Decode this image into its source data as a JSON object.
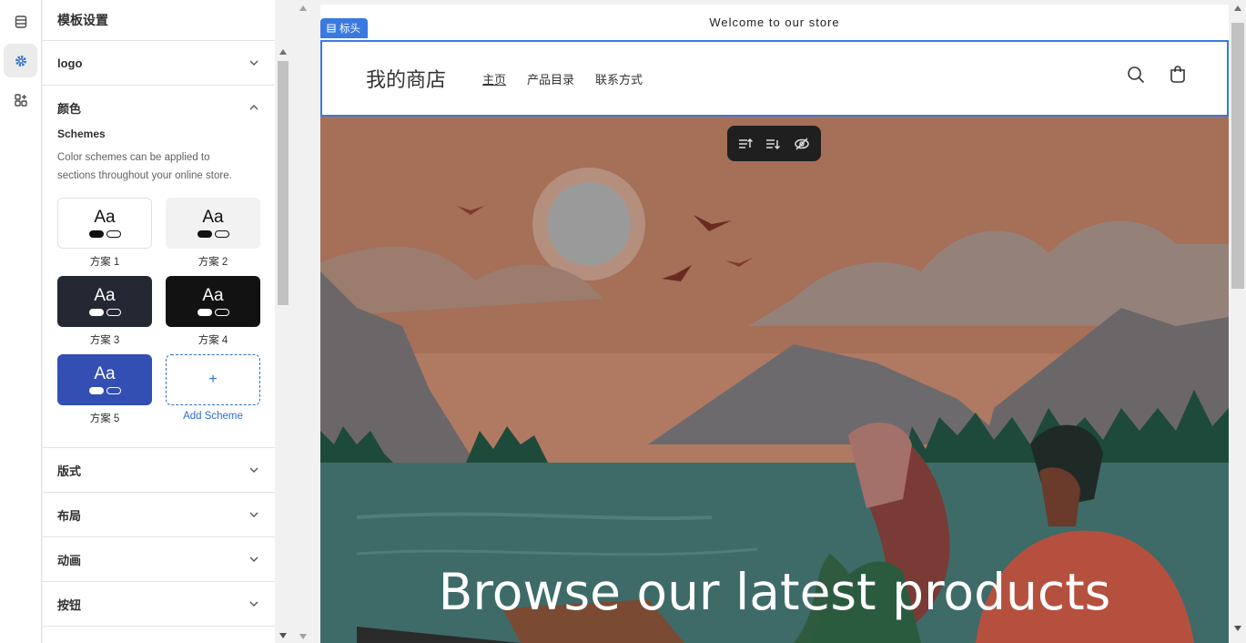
{
  "panel": {
    "title": "模板设置",
    "sections": {
      "logo": "logo",
      "colors": "颜色",
      "typography": "版式",
      "layout": "布局",
      "animation": "动画",
      "buttons": "按钮"
    },
    "schemes_title": "Schemes",
    "schemes_desc": "Color schemes can be applied to sections throughout your online store.",
    "schemes": [
      {
        "label": "方案 1",
        "sample": "Aa",
        "bg": "#ffffff",
        "fg": "#111111"
      },
      {
        "label": "方案 2",
        "sample": "Aa",
        "bg": "#f2f2f2",
        "fg": "#111111"
      },
      {
        "label": "方案 3",
        "sample": "Aa",
        "bg": "#242833",
        "fg": "#ffffff"
      },
      {
        "label": "方案 4",
        "sample": "Aa",
        "bg": "#121212",
        "fg": "#ffffff"
      },
      {
        "label": "方案 5",
        "sample": "Aa",
        "bg": "#334fb4",
        "fg": "#ffffff"
      }
    ],
    "add_scheme_icon": "+",
    "add_scheme_label": "Add Scheme"
  },
  "preview": {
    "announcement": "Welcome to our store",
    "section_tag": "标头",
    "store_name": "我的商店",
    "nav": [
      "主页",
      "产品目录",
      "联系方式"
    ],
    "hero_heading": "Browse our latest products"
  },
  "colors": {
    "accent": "#3a7ae0",
    "link": "#2c6ecb"
  }
}
